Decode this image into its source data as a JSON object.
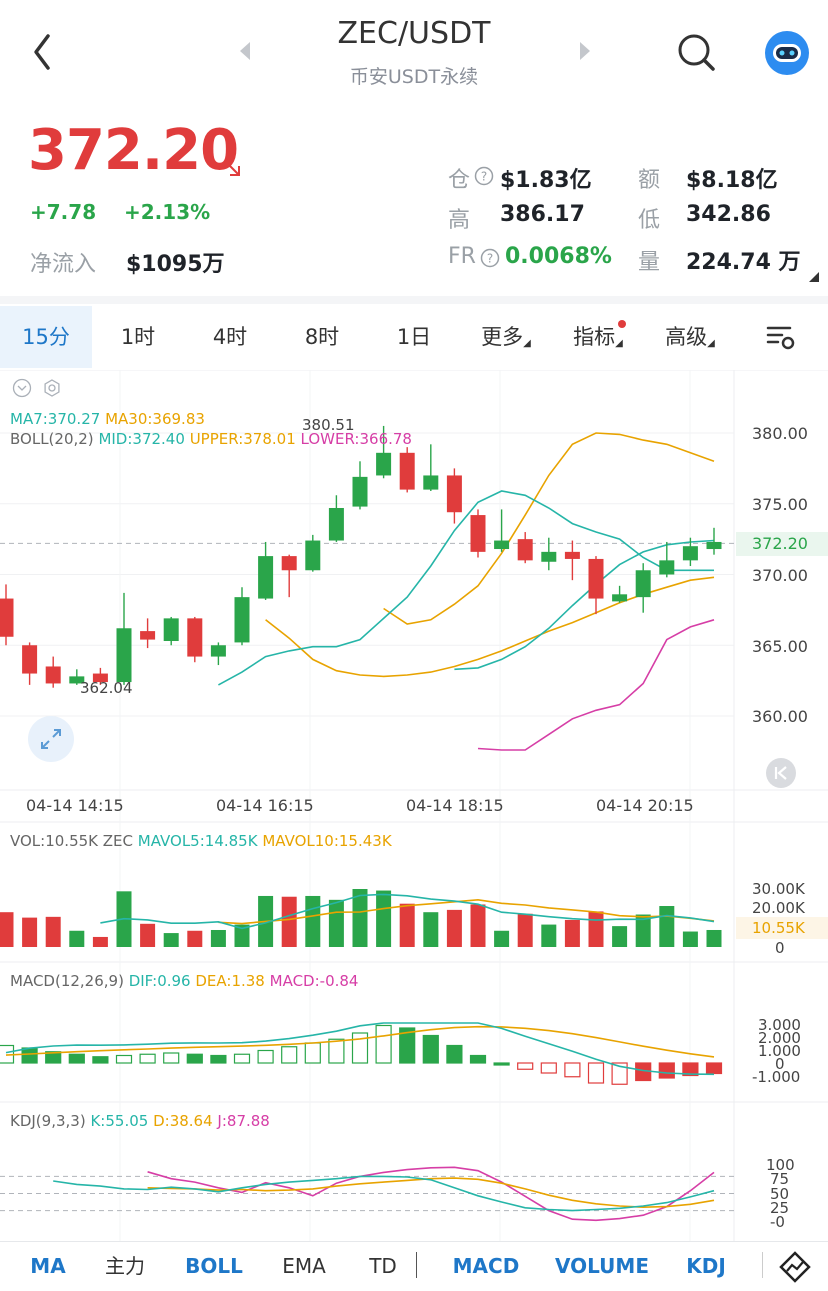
{
  "header": {
    "title": "ZEC/USDT",
    "subtitle": "币安USDT永续"
  },
  "price": {
    "last": "372.20",
    "change": "+7.78",
    "change_pct": "+2.13%",
    "netflow_label": "净流入",
    "netflow_value": "$1095万"
  },
  "stats": {
    "oi_label": "仓",
    "oi_value": "$1.83亿",
    "amount_label": "额",
    "amount_value": "$8.18亿",
    "high_label": "高",
    "high_value": "386.17",
    "low_label": "低",
    "low_value": "342.86",
    "fr_label": "FR",
    "fr_value": "0.0068%",
    "volume_label": "量",
    "volume_value": "224.74 万"
  },
  "tabs": [
    {
      "label": "15分"
    },
    {
      "label": "1时"
    },
    {
      "label": "4时"
    },
    {
      "label": "8时"
    },
    {
      "label": "1日"
    },
    {
      "label": "更多"
    },
    {
      "label": "指标"
    },
    {
      "label": "高级"
    }
  ],
  "main_chart": {
    "ma_legend": {
      "ma7": "MA7:370.27",
      "ma30": "MA30:369.83"
    },
    "boll_legend": {
      "name": "BOLL(20,2)",
      "mid": "MID:372.40",
      "upper": "UPPER:378.01",
      "lower": "LOWER:366.78"
    },
    "high_marker": "380.51",
    "low_marker": "362.04",
    "y_ticks": [
      "380.00",
      "375.00",
      "370.00",
      "365.00",
      "360.00"
    ],
    "last_price_tag": "372.20",
    "x_ticks": [
      "04-14 14:15",
      "04-14 16:15",
      "04-14 18:15",
      "04-14 20:15"
    ]
  },
  "vol_chart": {
    "legend": {
      "vol": "VOL:10.55K ZEC",
      "mavol5": "MAVOL5:14.85K",
      "mavol10": "MAVOL10:15.43K"
    },
    "y_ticks": [
      "30.00K",
      "20.00K",
      "0"
    ],
    "last_tag": "10.55K"
  },
  "macd_chart": {
    "legend": {
      "name": "MACD(12,26,9)",
      "dif": "DIF:0.96",
      "dea": "DEA:1.38",
      "macd": "MACD:-0.84"
    },
    "y_ticks": [
      "3.000",
      "2.000",
      "1.000",
      "0",
      "-1.000"
    ]
  },
  "kdj_chart": {
    "legend": {
      "name": "KDJ(9,3,3)",
      "k": "K:55.05",
      "d": "D:38.64",
      "j": "J:87.88"
    },
    "y_ticks": [
      "100",
      "75",
      "50",
      "25",
      "-0"
    ]
  },
  "bottom_bar": [
    {
      "label": "MA",
      "active": true
    },
    {
      "label": "主力",
      "active": false
    },
    {
      "label": "BOLL",
      "active": true
    },
    {
      "label": "EMA",
      "active": false
    },
    {
      "label": "TD",
      "active": false
    },
    {
      "label": "MACD",
      "active": true
    },
    {
      "label": "VOLUME",
      "active": true
    },
    {
      "label": "KDJ",
      "active": true
    }
  ],
  "colors": {
    "up": "#2aa54a",
    "down": "#e03c3c",
    "ma7": "#26b5a8",
    "ma30": "#e8a300",
    "boll_lower": "#d63ea6",
    "accent": "#1e77c8"
  },
  "chart_data": {
    "type": "candlestick",
    "interval": "15分",
    "candles": [
      {
        "o": 368.3,
        "c": 365.6,
        "h": 369.3,
        "l": 365.0
      },
      {
        "o": 365.0,
        "c": 363.0,
        "h": 365.2,
        "l": 362.2
      },
      {
        "o": 363.5,
        "c": 362.3,
        "h": 364.2,
        "l": 362.0
      },
      {
        "o": 362.3,
        "c": 362.8,
        "h": 363.3,
        "l": 362.2
      },
      {
        "o": 363.0,
        "c": 362.4,
        "h": 363.4,
        "l": 362.2
      },
      {
        "o": 362.4,
        "c": 366.2,
        "h": 368.7,
        "l": 362.2
      },
      {
        "o": 366.0,
        "c": 365.4,
        "h": 366.9,
        "l": 364.8
      },
      {
        "o": 365.3,
        "c": 366.9,
        "h": 367.0,
        "l": 365.0
      },
      {
        "o": 366.9,
        "c": 364.2,
        "h": 367.0,
        "l": 363.8
      },
      {
        "o": 364.2,
        "c": 365.0,
        "h": 365.2,
        "l": 363.6
      },
      {
        "o": 365.2,
        "c": 368.4,
        "h": 369.1,
        "l": 365.0
      },
      {
        "o": 368.3,
        "c": 371.3,
        "h": 372.3,
        "l": 368.2
      },
      {
        "o": 371.3,
        "c": 370.3,
        "h": 371.4,
        "l": 368.4
      },
      {
        "o": 370.3,
        "c": 372.4,
        "h": 372.8,
        "l": 370.2
      },
      {
        "o": 372.4,
        "c": 374.7,
        "h": 375.6,
        "l": 372.3
      },
      {
        "o": 374.8,
        "c": 376.9,
        "h": 378.0,
        "l": 374.6
      },
      {
        "o": 377.0,
        "c": 378.6,
        "h": 380.5,
        "l": 376.8
      },
      {
        "o": 378.6,
        "c": 376.0,
        "h": 379.0,
        "l": 375.8
      },
      {
        "o": 376.0,
        "c": 377.0,
        "h": 379.2,
        "l": 375.9
      },
      {
        "o": 377.0,
        "c": 374.4,
        "h": 377.5,
        "l": 373.6
      },
      {
        "o": 374.2,
        "c": 371.6,
        "h": 374.6,
        "l": 371.2
      },
      {
        "o": 371.8,
        "c": 372.4,
        "h": 374.6,
        "l": 371.6
      },
      {
        "o": 372.5,
        "c": 371.0,
        "h": 373.0,
        "l": 370.8
      },
      {
        "o": 370.9,
        "c": 371.6,
        "h": 372.6,
        "l": 370.3
      },
      {
        "o": 371.6,
        "c": 371.1,
        "h": 372.4,
        "l": 369.6
      },
      {
        "o": 371.1,
        "c": 368.3,
        "h": 371.3,
        "l": 367.2
      },
      {
        "o": 368.1,
        "c": 368.6,
        "h": 369.2,
        "l": 368.0
      },
      {
        "o": 368.4,
        "c": 370.3,
        "h": 370.8,
        "l": 367.3
      },
      {
        "o": 370.0,
        "c": 371.0,
        "h": 372.3,
        "l": 369.8
      },
      {
        "o": 371.0,
        "c": 372.0,
        "h": 372.6,
        "l": 370.6
      },
      {
        "o": 371.8,
        "c": 372.3,
        "h": 373.3,
        "l": 371.4
      }
    ],
    "ma7": [
      362.2,
      363.1,
      364.2,
      364.6,
      364.9,
      364.9,
      365.4,
      366.9,
      368.4,
      370.6,
      373.1,
      375.1,
      375.9,
      375.6,
      374.7,
      373.6,
      373.0,
      372.5,
      371.2,
      370.3,
      370.3,
      370.3
    ],
    "ma30": [
      366.8,
      365.5,
      364.0,
      363.2,
      362.9,
      362.8,
      362.9,
      363.1,
      363.5,
      364.0,
      364.6,
      365.3,
      366.0,
      366.6,
      367.3,
      368.0,
      368.6,
      369.1,
      369.6,
      369.8
    ],
    "boll_upper": [
      367.6,
      366.5,
      366.8,
      367.9,
      369.2,
      371.5,
      374.2,
      377.0,
      379.2,
      380.0,
      379.9,
      379.5,
      379.2,
      378.6,
      378.0
    ],
    "boll_mid": [
      363.3,
      363.4,
      364.0,
      364.9,
      366.2,
      367.8,
      369.3,
      370.7,
      371.6,
      372.1,
      372.3,
      372.4
    ],
    "boll_lower": [
      357.7,
      357.6,
      357.6,
      358.7,
      359.8,
      360.4,
      360.8,
      362.3,
      365.4,
      366.3,
      366.8
    ],
    "volume": [
      22.5,
      19.0,
      19.5,
      10.5,
      6.5,
      36.0,
      15.0,
      9.0,
      10.5,
      11.0,
      14.5,
      33.0,
      32.5,
      33.0,
      30.5,
      37.5,
      36.5,
      28.0,
      22.5,
      24.0,
      27.5,
      10.5,
      21.5,
      14.5,
      17.5,
      23.0,
      13.5,
      21.0,
      26.5,
      10.0,
      11.0
    ],
    "macd_hist": [
      1.4,
      1.2,
      0.9,
      0.7,
      0.5,
      0.6,
      0.7,
      0.8,
      0.7,
      0.6,
      0.7,
      1.0,
      1.3,
      1.6,
      1.9,
      2.4,
      3.0,
      2.8,
      2.2,
      1.4,
      0.6,
      0.0,
      -0.5,
      -0.8,
      -1.1,
      -1.6,
      -1.7,
      -1.4,
      -1.2,
      -1.0,
      -0.84
    ],
    "kdj_k": [
      72,
      66,
      63,
      58,
      57,
      61,
      58,
      53,
      60,
      66,
      70,
      73,
      76,
      80,
      80,
      79,
      74,
      60,
      46,
      35,
      25,
      22,
      20,
      22,
      24,
      28,
      34,
      44,
      55
    ],
    "kdj_d": [
      60,
      59,
      58,
      56,
      57,
      55,
      56,
      58,
      63,
      67,
      70,
      73,
      76,
      77,
      75,
      68,
      58,
      47,
      38,
      32,
      28,
      26,
      27,
      31,
      38
    ],
    "kdj_j": [
      88,
      76,
      70,
      60,
      52,
      69,
      60,
      46,
      68,
      80,
      87,
      92,
      95,
      96,
      90,
      70,
      45,
      20,
      5,
      3,
      6,
      12,
      27,
      55,
      87
    ]
  }
}
